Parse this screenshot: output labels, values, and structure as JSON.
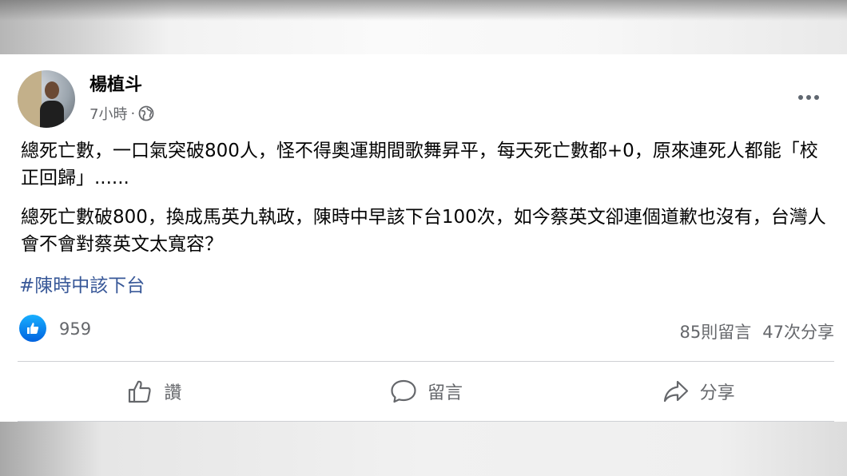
{
  "post": {
    "author": "楊植斗",
    "time": "7小時",
    "separator": "·",
    "paragraph1": "總死亡數，一口氣突破800人，怪不得奧運期間歌舞昇平，每天死亡數都+0，原來連死人都能「校正回歸」......",
    "paragraph2": "總死亡數破800，換成馬英九執政，陳時中早該下台100次，如今蔡英文卻連個道歉也沒有，台灣人會不會對蔡英文太寬容？",
    "hashtag": "#陳時中該下台"
  },
  "reactions": {
    "like_count": "959",
    "comments": "85則留言",
    "shares": "47次分享"
  },
  "actions": {
    "like": "讚",
    "comment": "留言",
    "share": "分享"
  },
  "colors": {
    "text": "#050505",
    "secondary": "#65676b",
    "link": "#385898",
    "like_blue": "#1877f2"
  },
  "icons": [
    "globe-icon",
    "more-icon",
    "like-reaction-icon",
    "thumbs-up-icon",
    "comment-icon",
    "share-icon"
  ]
}
